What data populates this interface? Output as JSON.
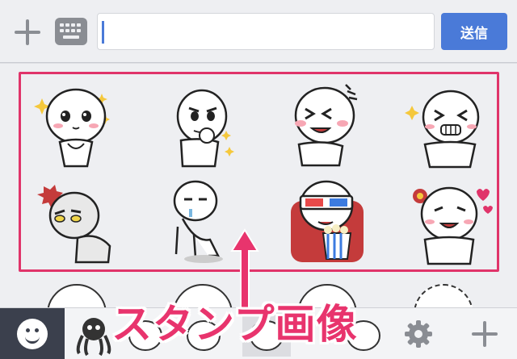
{
  "input_bar": {
    "add_icon": "plus-icon",
    "keyboard_icon": "keyboard-icon",
    "message_value": "",
    "send_label": "送信"
  },
  "sticker_panel": {
    "stickers": [
      {
        "name": "sparkle-eyes-sticker"
      },
      {
        "name": "thinking-sticker"
      },
      {
        "name": "laughing-sticker"
      },
      {
        "name": "excited-sticker"
      },
      {
        "name": "angry-bump-sticker"
      },
      {
        "name": "exhausted-sticker"
      },
      {
        "name": "3d-movie-popcorn-sticker"
      },
      {
        "name": "love-flower-sticker"
      }
    ],
    "colors": {
      "highlight": "#e0346a",
      "annotation": "#e8346d",
      "send": "#4a7ad8"
    }
  },
  "annotation": {
    "text": "スタンプ画像",
    "arrow_icon": "up-arrow-icon"
  },
  "tab_bar": {
    "emoji_icon": "smiley-icon",
    "settings_icon": "gear-icon",
    "add_icon": "plus-icon"
  }
}
